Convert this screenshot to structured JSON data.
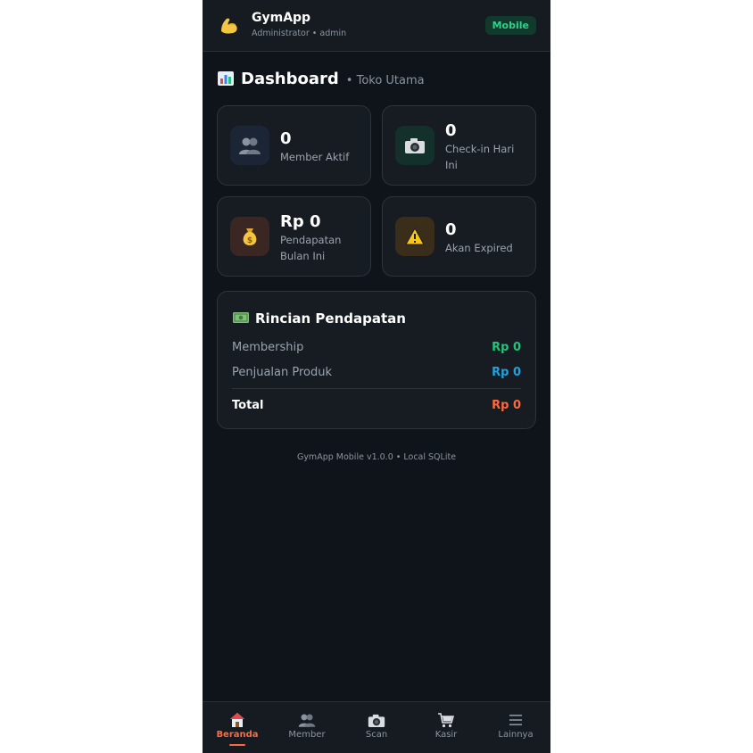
{
  "header": {
    "app_name": "GymApp",
    "user_line": "Administrator • admin",
    "badge": "Mobile",
    "logo_icon": "flexed-biceps-icon"
  },
  "dashboard": {
    "title": "Dashboard",
    "store": "• Toko Utama",
    "icon": "bar-chart-icon"
  },
  "stats": [
    {
      "icon": "members-icon",
      "value": "0",
      "label": "Member Aktif",
      "color": "#1c2536"
    },
    {
      "icon": "camera-icon",
      "value": "0",
      "label": "Check-in Hari Ini",
      "color": "#13302b"
    },
    {
      "icon": "money-bag-icon",
      "value": "Rp 0",
      "label": "Pendapatan Bulan Ini",
      "color": "#3a2622"
    },
    {
      "icon": "warning-icon",
      "value": "0",
      "label": "Akan Expired",
      "color": "#3a2e1a"
    }
  ],
  "income": {
    "title": "Rincian Pendapatan",
    "icon": "banknote-icon",
    "rows": [
      {
        "label": "Membership",
        "value": "Rp 0",
        "color": "#22c37a"
      },
      {
        "label": "Penjualan Produk",
        "value": "Rp 0",
        "color": "#1ea3e0"
      }
    ],
    "total": {
      "label": "Total",
      "value": "Rp 0",
      "color": "#ff6a3d"
    }
  },
  "footer": {
    "version": "GymApp Mobile v1.0.0 • Local SQLite"
  },
  "nav": [
    {
      "label": "Beranda",
      "icon": "home-icon",
      "active": true
    },
    {
      "label": "Member",
      "icon": "members-icon",
      "active": false
    },
    {
      "label": "Scan",
      "icon": "camera-icon",
      "active": false
    },
    {
      "label": "Kasir",
      "icon": "cart-icon",
      "active": false
    },
    {
      "label": "Lainnya",
      "icon": "menu-icon",
      "active": false
    }
  ],
  "colors": {
    "accent": "#ff6a3d",
    "background": "#0f131a",
    "card": "#171c23",
    "badge": "#2fd18a"
  }
}
